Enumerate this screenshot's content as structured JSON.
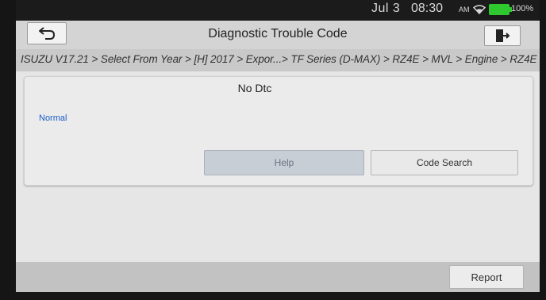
{
  "status_bar": {
    "date": "Jul 3",
    "time": "08:30",
    "ampm": "AM",
    "battery": "100%",
    "battery_color": "#2ec92e"
  },
  "header": {
    "title": "Diagnostic Trouble Code",
    "back_icon": "back-arrow-icon",
    "exit_icon": "exit-door-icon"
  },
  "breadcrumb": {
    "path": "ISUZU V17.21 > Select From Year > [H] 2017 > Expor...> TF Series (D-MAX) > RZ4E > MVL > Engine > RZ4E"
  },
  "dtc_panel": {
    "title": "No Dtc",
    "status": "Normal",
    "status_color": "#1a5fc7",
    "help_label": "Help",
    "code_search_label": "Code Search"
  },
  "footer": {
    "report_label": "Report"
  }
}
